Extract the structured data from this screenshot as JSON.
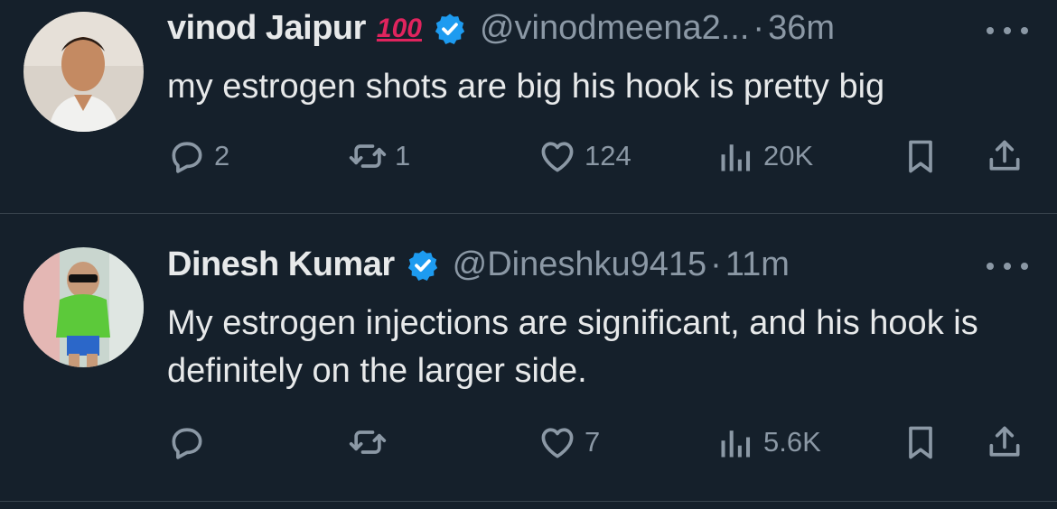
{
  "tweets": [
    {
      "name": "vinod Jaipur",
      "badge_emoji": "100",
      "verified": true,
      "handle": "@vinodmeena2...",
      "separator": "·",
      "time": "36m",
      "text": "my estrogen shots are big his hook is pretty big",
      "replies": "2",
      "retweets": "1",
      "likes": "124",
      "views": "20K"
    },
    {
      "name": "Dinesh Kumar",
      "verified": true,
      "handle": "@Dineshku9415",
      "separator": "·",
      "time": "11m",
      "text": "My estrogen injections are significant, and his hook is definitely on the larger side.",
      "replies": "",
      "retweets": "",
      "likes": "7",
      "views": "5.6K"
    }
  ],
  "colors": {
    "background": "#15202b",
    "text": "#e7e9ea",
    "muted": "#8b98a5",
    "verified": "#1d9bf0",
    "divider": "#38444d"
  }
}
